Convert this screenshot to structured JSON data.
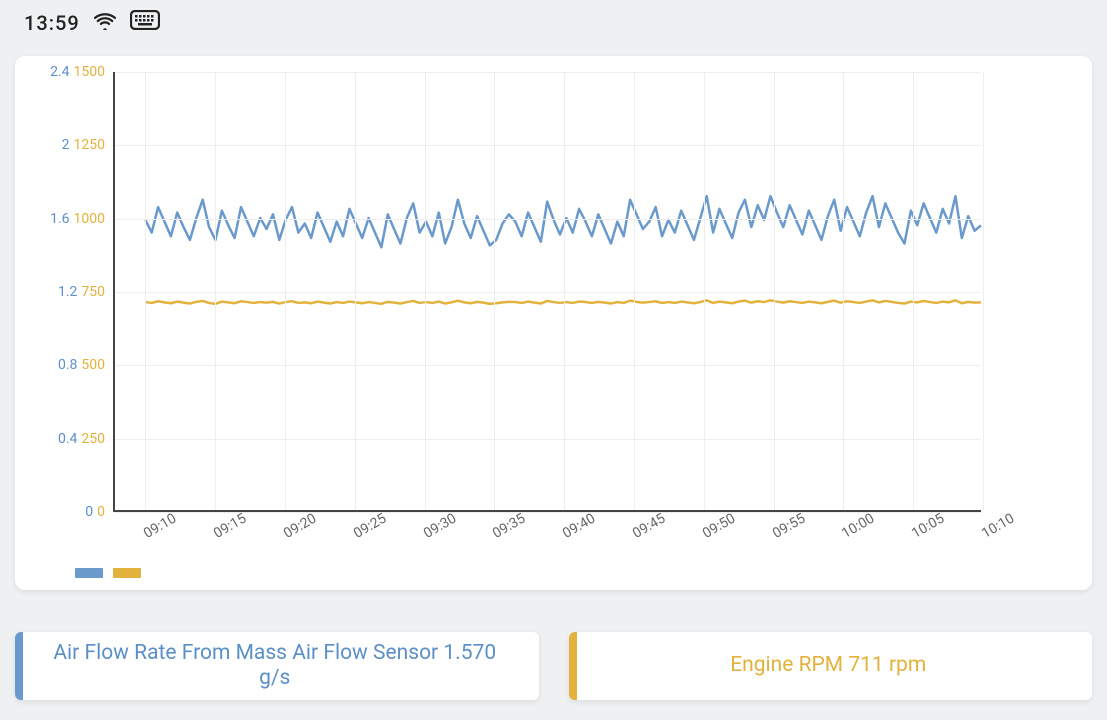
{
  "status_bar": {
    "time": "13:59"
  },
  "chart_data": {
    "type": "line",
    "x_labels": [
      "09:10",
      "09:15",
      "09:20",
      "09:25",
      "09:30",
      "09:35",
      "09:40",
      "09:45",
      "09:50",
      "09:55",
      "10:00",
      "10:05",
      "10:10"
    ],
    "y_axes": [
      {
        "name": "Air Flow Rate",
        "color": "#6a99cc",
        "ticks": [
          0,
          0.4,
          0.8,
          1.2,
          1.6,
          2.0,
          2.4
        ],
        "min": 0,
        "max": 2.4
      },
      {
        "name": "Engine RPM",
        "color": "#e3b23c",
        "ticks": [
          0,
          250,
          500,
          750,
          1000,
          1250,
          1500
        ],
        "min": 0,
        "max": 1500
      }
    ],
    "series": [
      {
        "name": "Air Flow Rate From Mass Air Flow Sensor",
        "axis": 0,
        "color": "#6a99cc",
        "values": [
          1.59,
          1.52,
          1.66,
          1.58,
          1.5,
          1.63,
          1.55,
          1.48,
          1.6,
          1.7,
          1.55,
          1.48,
          1.64,
          1.56,
          1.49,
          1.66,
          1.58,
          1.5,
          1.6,
          1.54,
          1.62,
          1.48,
          1.59,
          1.66,
          1.52,
          1.57,
          1.49,
          1.63,
          1.55,
          1.47,
          1.58,
          1.5,
          1.65,
          1.57,
          1.49,
          1.6,
          1.52,
          1.44,
          1.62,
          1.54,
          1.46,
          1.6,
          1.68,
          1.52,
          1.58,
          1.5,
          1.63,
          1.46,
          1.55,
          1.7,
          1.57,
          1.49,
          1.61,
          1.53,
          1.45,
          1.48,
          1.57,
          1.62,
          1.58,
          1.5,
          1.63,
          1.55,
          1.47,
          1.69,
          1.59,
          1.51,
          1.6,
          1.52,
          1.65,
          1.58,
          1.5,
          1.62,
          1.54,
          1.46,
          1.58,
          1.5,
          1.7,
          1.62,
          1.54,
          1.58,
          1.66,
          1.5,
          1.59,
          1.52,
          1.64,
          1.56,
          1.48,
          1.6,
          1.72,
          1.52,
          1.65,
          1.57,
          1.49,
          1.63,
          1.7,
          1.55,
          1.67,
          1.59,
          1.72,
          1.63,
          1.55,
          1.67,
          1.59,
          1.51,
          1.64,
          1.56,
          1.48,
          1.61,
          1.7,
          1.53,
          1.66,
          1.58,
          1.5,
          1.63,
          1.72,
          1.55,
          1.68,
          1.6,
          1.52,
          1.46,
          1.64,
          1.56,
          1.68,
          1.6,
          1.52,
          1.65,
          1.57,
          1.72,
          1.49,
          1.61,
          1.53,
          1.56
        ]
      },
      {
        "name": "Engine RPM",
        "axis": 1,
        "color": "#e3b23c",
        "values": [
          712,
          709,
          715,
          711,
          708,
          714,
          710,
          707,
          713,
          716,
          709,
          706,
          714,
          711,
          708,
          715,
          712,
          709,
          712,
          710,
          713,
          707,
          712,
          715,
          709,
          711,
          708,
          714,
          710,
          707,
          712,
          709,
          714,
          711,
          708,
          712,
          709,
          706,
          713,
          710,
          707,
          712,
          716,
          709,
          712,
          709,
          714,
          707,
          711,
          717,
          711,
          708,
          713,
          710,
          706,
          708,
          711,
          713,
          712,
          709,
          714,
          710,
          707,
          716,
          712,
          709,
          712,
          709,
          714,
          712,
          709,
          713,
          710,
          707,
          712,
          709,
          717,
          713,
          710,
          712,
          715,
          709,
          712,
          709,
          714,
          711,
          708,
          712,
          718,
          709,
          714,
          711,
          708,
          714,
          717,
          710,
          715,
          712,
          718,
          714,
          710,
          715,
          712,
          709,
          714,
          711,
          708,
          713,
          717,
          710,
          715,
          712,
          709,
          714,
          718,
          711,
          716,
          713,
          709,
          707,
          714,
          711,
          716,
          712,
          709,
          714,
          711,
          718,
          708,
          713,
          710,
          711
        ]
      }
    ]
  },
  "y_tick_labels": {
    "blue": [
      "0",
      "0.4",
      "0.8",
      "1.2",
      "1.6",
      "2",
      "2.4"
    ],
    "gold": [
      "0",
      "250",
      "500",
      "750",
      "1000",
      "1250",
      "1500"
    ]
  },
  "info_cards": {
    "maf": "Air Flow Rate From Mass Air Flow Sensor 1.570 g/s",
    "rpm": "Engine RPM 711 rpm"
  }
}
